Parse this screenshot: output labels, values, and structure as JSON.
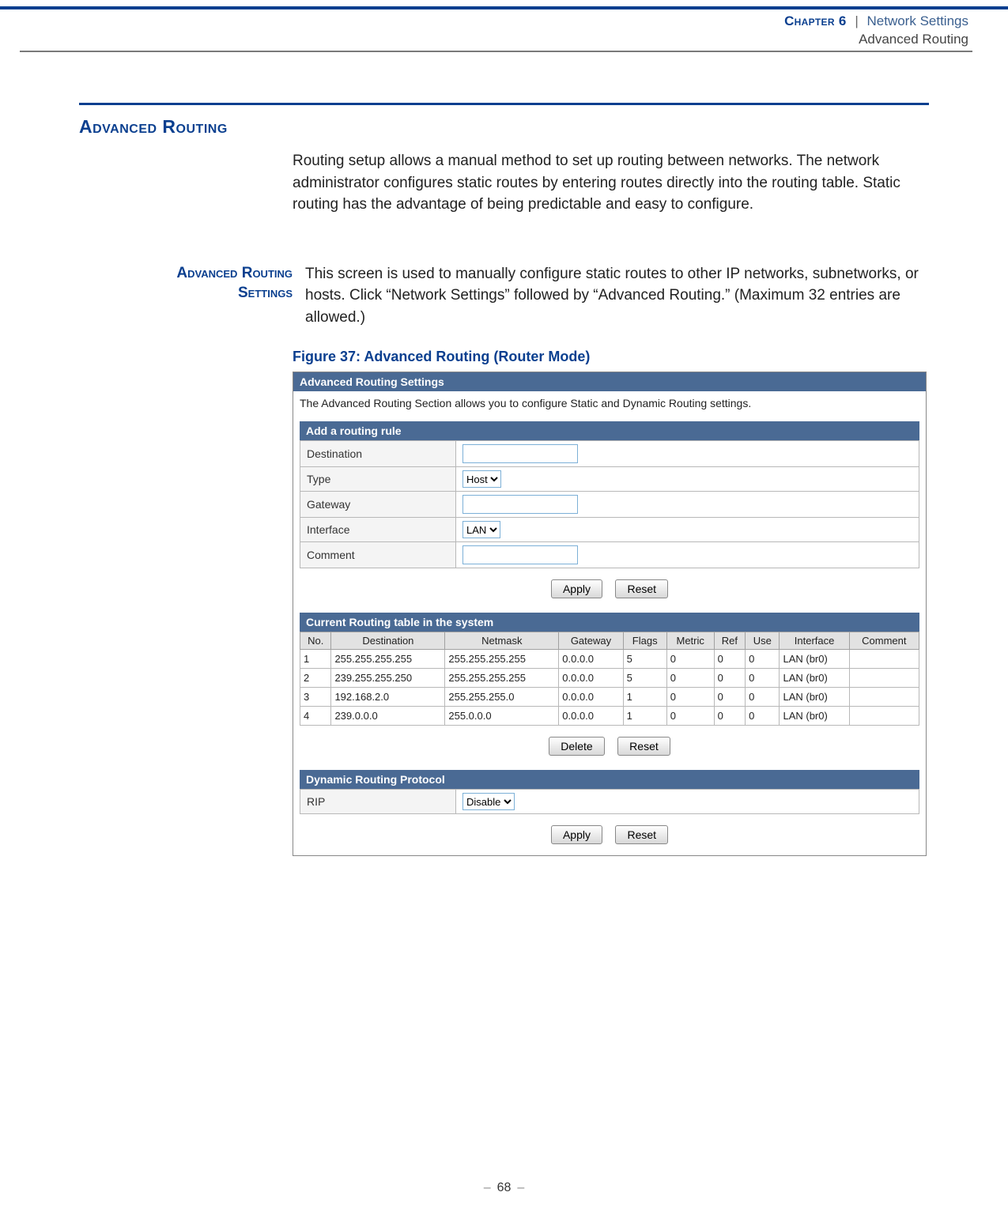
{
  "header": {
    "chapter_label": "Chapter 6",
    "separator": "|",
    "section": "Network Settings",
    "crumb": "Advanced Routing"
  },
  "h1": "Advanced Routing",
  "intro": "Routing setup allows a manual method to set up routing between networks. The network administrator configures static routes by entering routes directly into the routing table. Static routing has the advantage of being predictable and easy to configure.",
  "sub": {
    "label_a": "Advanced Routing",
    "label_b": "Settings",
    "text": "This screen is used to manually configure static routes to other IP networks, subnetworks, or hosts. Click “Network Settings” followed by “Advanced Routing.” (Maximum 32 entries are allowed.)"
  },
  "figure_caption": "Figure 37:  Advanced Routing (Router Mode)",
  "panel": {
    "ars_title": "Advanced Routing Settings",
    "ars_desc": "The Advanced Routing Section allows you to configure Static and Dynamic Routing settings.",
    "add_title": "Add a routing rule",
    "form": {
      "destination": "Destination",
      "type": "Type",
      "type_value": "Host",
      "gateway": "Gateway",
      "interface": "Interface",
      "interface_value": "LAN",
      "comment": "Comment"
    },
    "btn_apply": "Apply",
    "btn_reset": "Reset",
    "table_title": "Current Routing table in the system",
    "cols": {
      "no": "No.",
      "dest": "Destination",
      "mask": "Netmask",
      "gw": "Gateway",
      "flags": "Flags",
      "metric": "Metric",
      "ref": "Ref",
      "use": "Use",
      "iface": "Interface",
      "comment": "Comment"
    },
    "rows": [
      {
        "no": "1",
        "dest": "255.255.255.255",
        "mask": "255.255.255.255",
        "gw": "0.0.0.0",
        "flags": "5",
        "metric": "0",
        "ref": "0",
        "use": "0",
        "iface": "LAN (br0)",
        "comment": ""
      },
      {
        "no": "2",
        "dest": "239.255.255.250",
        "mask": "255.255.255.255",
        "gw": "0.0.0.0",
        "flags": "5",
        "metric": "0",
        "ref": "0",
        "use": "0",
        "iface": "LAN (br0)",
        "comment": ""
      },
      {
        "no": "3",
        "dest": "192.168.2.0",
        "mask": "255.255.255.0",
        "gw": "0.0.0.0",
        "flags": "1",
        "metric": "0",
        "ref": "0",
        "use": "0",
        "iface": "LAN (br0)",
        "comment": ""
      },
      {
        "no": "4",
        "dest": "239.0.0.0",
        "mask": "255.0.0.0",
        "gw": "0.0.0.0",
        "flags": "1",
        "metric": "0",
        "ref": "0",
        "use": "0",
        "iface": "LAN (br0)",
        "comment": ""
      }
    ],
    "btn_delete": "Delete",
    "dyn_title": "Dynamic Routing Protocol",
    "dyn_label": "RIP",
    "dyn_value": "Disable"
  },
  "page_number": "68"
}
